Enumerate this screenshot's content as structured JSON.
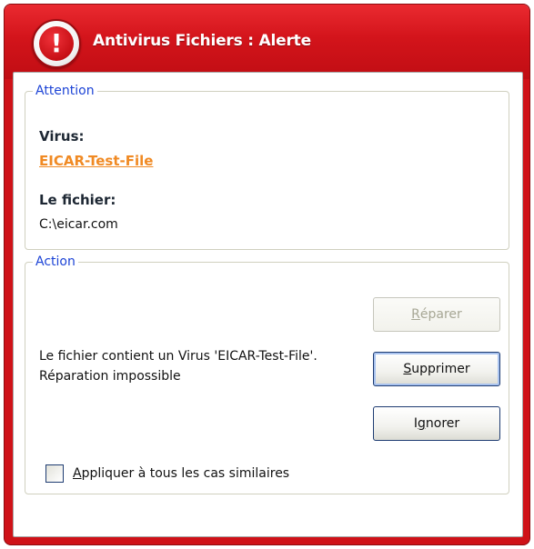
{
  "window": {
    "title": "Antivirus Fichiers : Alerte",
    "icon": "alert-exclamation-icon",
    "icon_glyph": "!",
    "frame_color": "#cf1218"
  },
  "attention": {
    "legend": "Attention",
    "virus_label": "Virus:",
    "virus_name": "EICAR-Test-File",
    "file_label": "Le fichier:",
    "file_path": "C:\\eicar.com"
  },
  "action": {
    "legend": "Action",
    "message": "Le fichier contient un Virus 'EICAR-Test-File'. Réparation impossible",
    "buttons": {
      "repair": {
        "accel": "R",
        "rest": "éparer",
        "enabled": false
      },
      "delete": {
        "accel": "S",
        "rest": "upprimer",
        "enabled": true
      },
      "ignore": {
        "pre": "I",
        "accel": "g",
        "rest": "norer",
        "enabled": true
      }
    },
    "apply_all": {
      "accel": "A",
      "rest": "ppliquer à tous les cas similaires",
      "checked": false
    }
  },
  "colors": {
    "legend": "#1d44d6",
    "virus_link": "#f08a24"
  }
}
